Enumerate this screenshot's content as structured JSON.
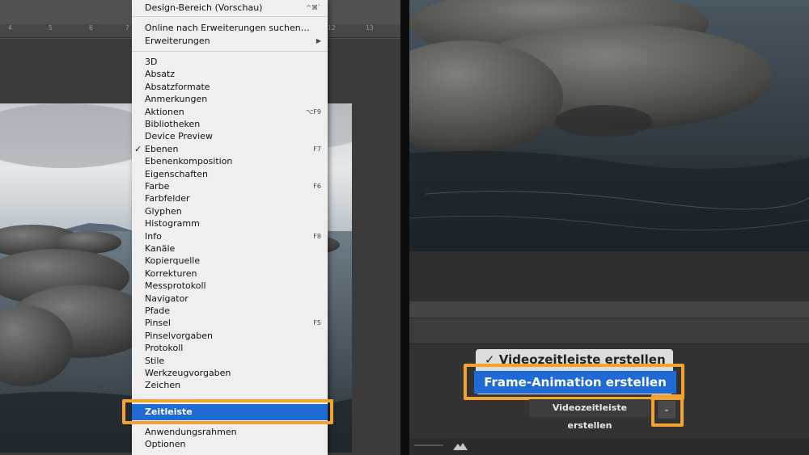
{
  "ruler": {
    "ticks": [
      "4",
      "5",
      "6",
      "7",
      "12",
      "13"
    ]
  },
  "menu": {
    "top_items": [
      {
        "label": "Design-Bereich (Vorschau)",
        "shortcut": "^⌘`"
      },
      {
        "label": "Online nach Erweiterungen suchen…",
        "shortcut": ""
      },
      {
        "label": "Erweiterungen",
        "shortcut": "▶"
      }
    ],
    "items": [
      {
        "label": "3D",
        "shortcut": "",
        "checked": false
      },
      {
        "label": "Absatz",
        "shortcut": "",
        "checked": false
      },
      {
        "label": "Absatzformate",
        "shortcut": "",
        "checked": false
      },
      {
        "label": "Anmerkungen",
        "shortcut": "",
        "checked": false
      },
      {
        "label": "Aktionen",
        "shortcut": "⌥F9",
        "checked": false
      },
      {
        "label": "Bibliotheken",
        "shortcut": "",
        "checked": false
      },
      {
        "label": "Device Preview",
        "shortcut": "",
        "checked": false
      },
      {
        "label": "Ebenen",
        "shortcut": "F7",
        "checked": true
      },
      {
        "label": "Ebenenkomposition",
        "shortcut": "",
        "checked": false
      },
      {
        "label": "Eigenschaften",
        "shortcut": "",
        "checked": false
      },
      {
        "label": "Farbe",
        "shortcut": "F6",
        "checked": false
      },
      {
        "label": "Farbfelder",
        "shortcut": "",
        "checked": false
      },
      {
        "label": "Glyphen",
        "shortcut": "",
        "checked": false
      },
      {
        "label": "Histogramm",
        "shortcut": "",
        "checked": false
      },
      {
        "label": "Info",
        "shortcut": "F8",
        "checked": false
      },
      {
        "label": "Kanäle",
        "shortcut": "",
        "checked": false
      },
      {
        "label": "Kopierquelle",
        "shortcut": "",
        "checked": false
      },
      {
        "label": "Korrekturen",
        "shortcut": "",
        "checked": false
      },
      {
        "label": "Messprotokoll",
        "shortcut": "",
        "checked": false
      },
      {
        "label": "Navigator",
        "shortcut": "",
        "checked": false
      },
      {
        "label": "Pfade",
        "shortcut": "",
        "checked": false
      },
      {
        "label": "Pinsel",
        "shortcut": "F5",
        "checked": false
      },
      {
        "label": "Pinselvorgaben",
        "shortcut": "",
        "checked": false
      },
      {
        "label": "Protokoll",
        "shortcut": "",
        "checked": false
      },
      {
        "label": "Stile",
        "shortcut": "",
        "checked": false
      },
      {
        "label": "Werkzeugvorgaben",
        "shortcut": "",
        "checked": false
      },
      {
        "label": "Zeichen",
        "shortcut": "",
        "checked": false
      }
    ],
    "highlighted": "Zeitleiste",
    "bottom_items": [
      {
        "label": "Anwendungsrahmen"
      },
      {
        "label": "Optionen"
      }
    ]
  },
  "timeline": {
    "popup_video": "✓ Videozeitleiste erstellen",
    "popup_frame": "Frame-Animation erstellen",
    "create_button": "Videozeitleiste erstellen",
    "dropdown_glyph": "⌄"
  },
  "colors": {
    "highlight_orange": "#f3a32f",
    "menu_selection_blue": "#1e6bd6",
    "menu_bg": "#efefef",
    "panel_dark": "#3a3a3a"
  },
  "icons": {
    "check": "checkmark-icon",
    "submenu": "submenu-arrow-icon",
    "dropdown": "chevron-down-icon",
    "mountain": "mountain-icon"
  }
}
